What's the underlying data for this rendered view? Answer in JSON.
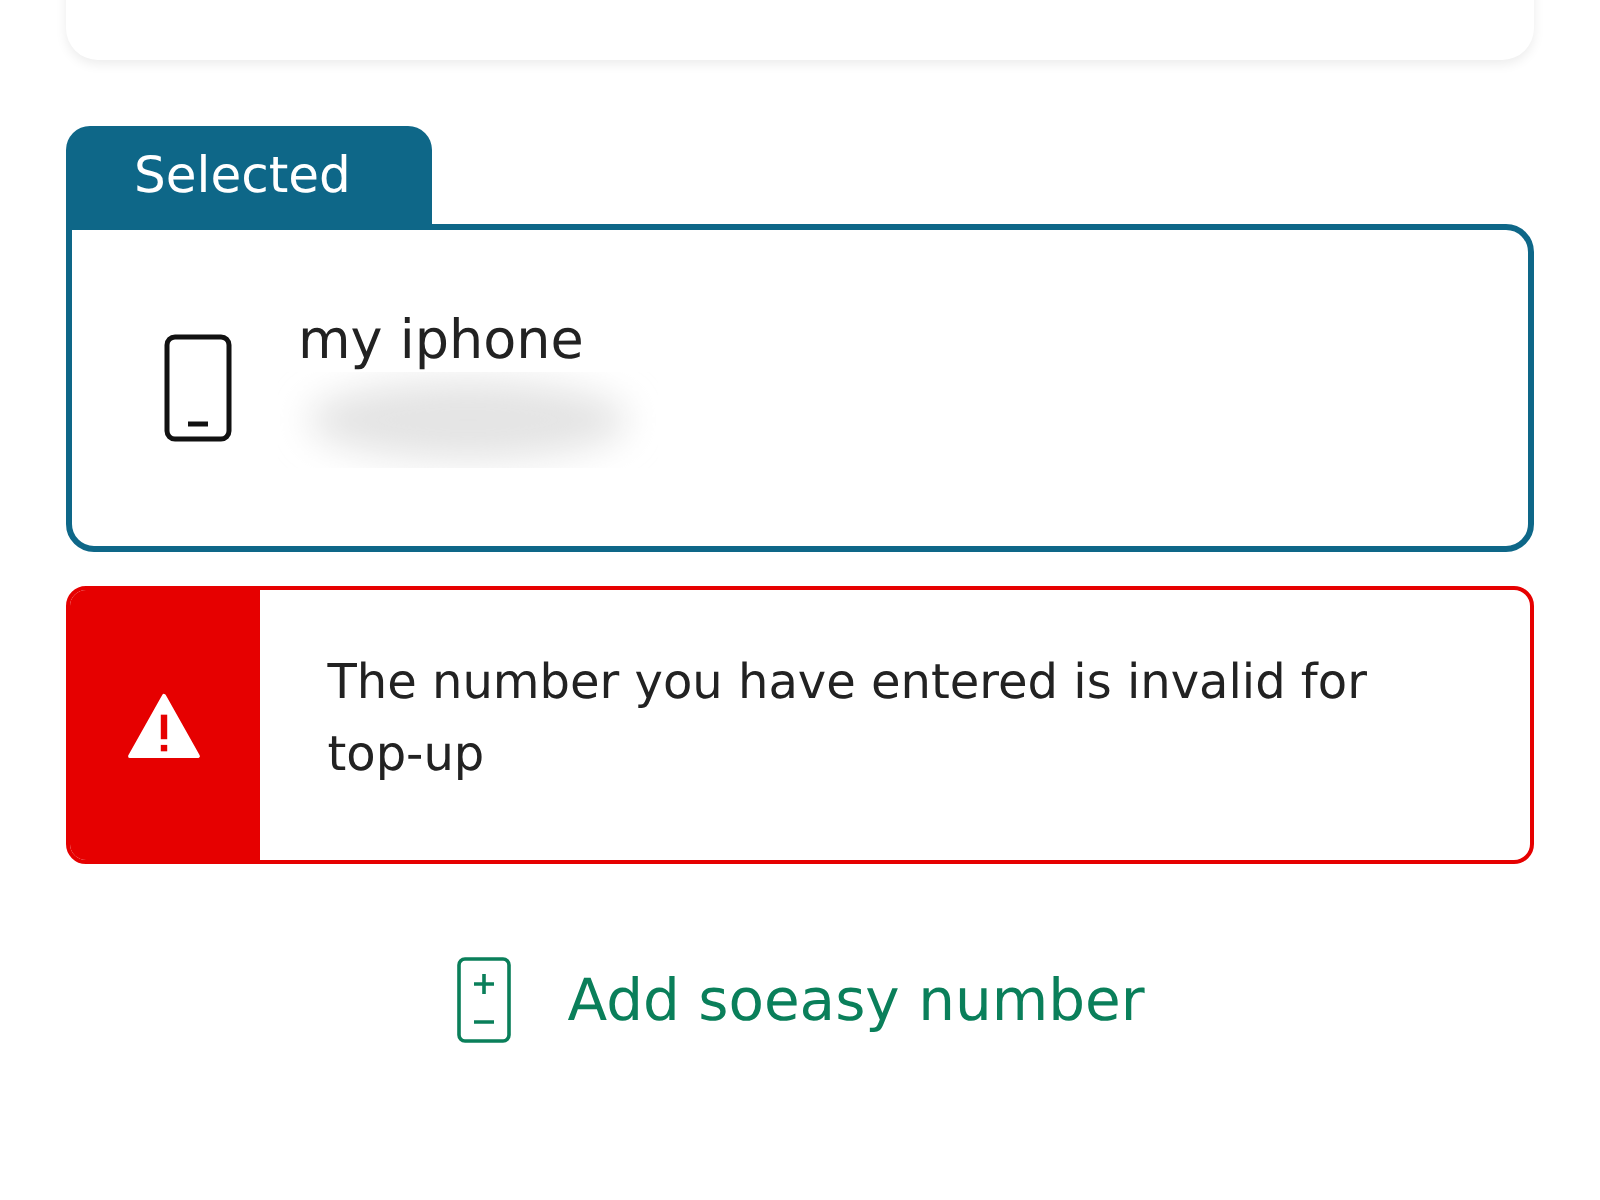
{
  "selected_device": {
    "tab_label": "Selected",
    "name": "my iphone",
    "selected": true
  },
  "error": {
    "message": "The number you have entered is invalid for top-up"
  },
  "add_button": {
    "label": "Add soeasy number"
  }
}
